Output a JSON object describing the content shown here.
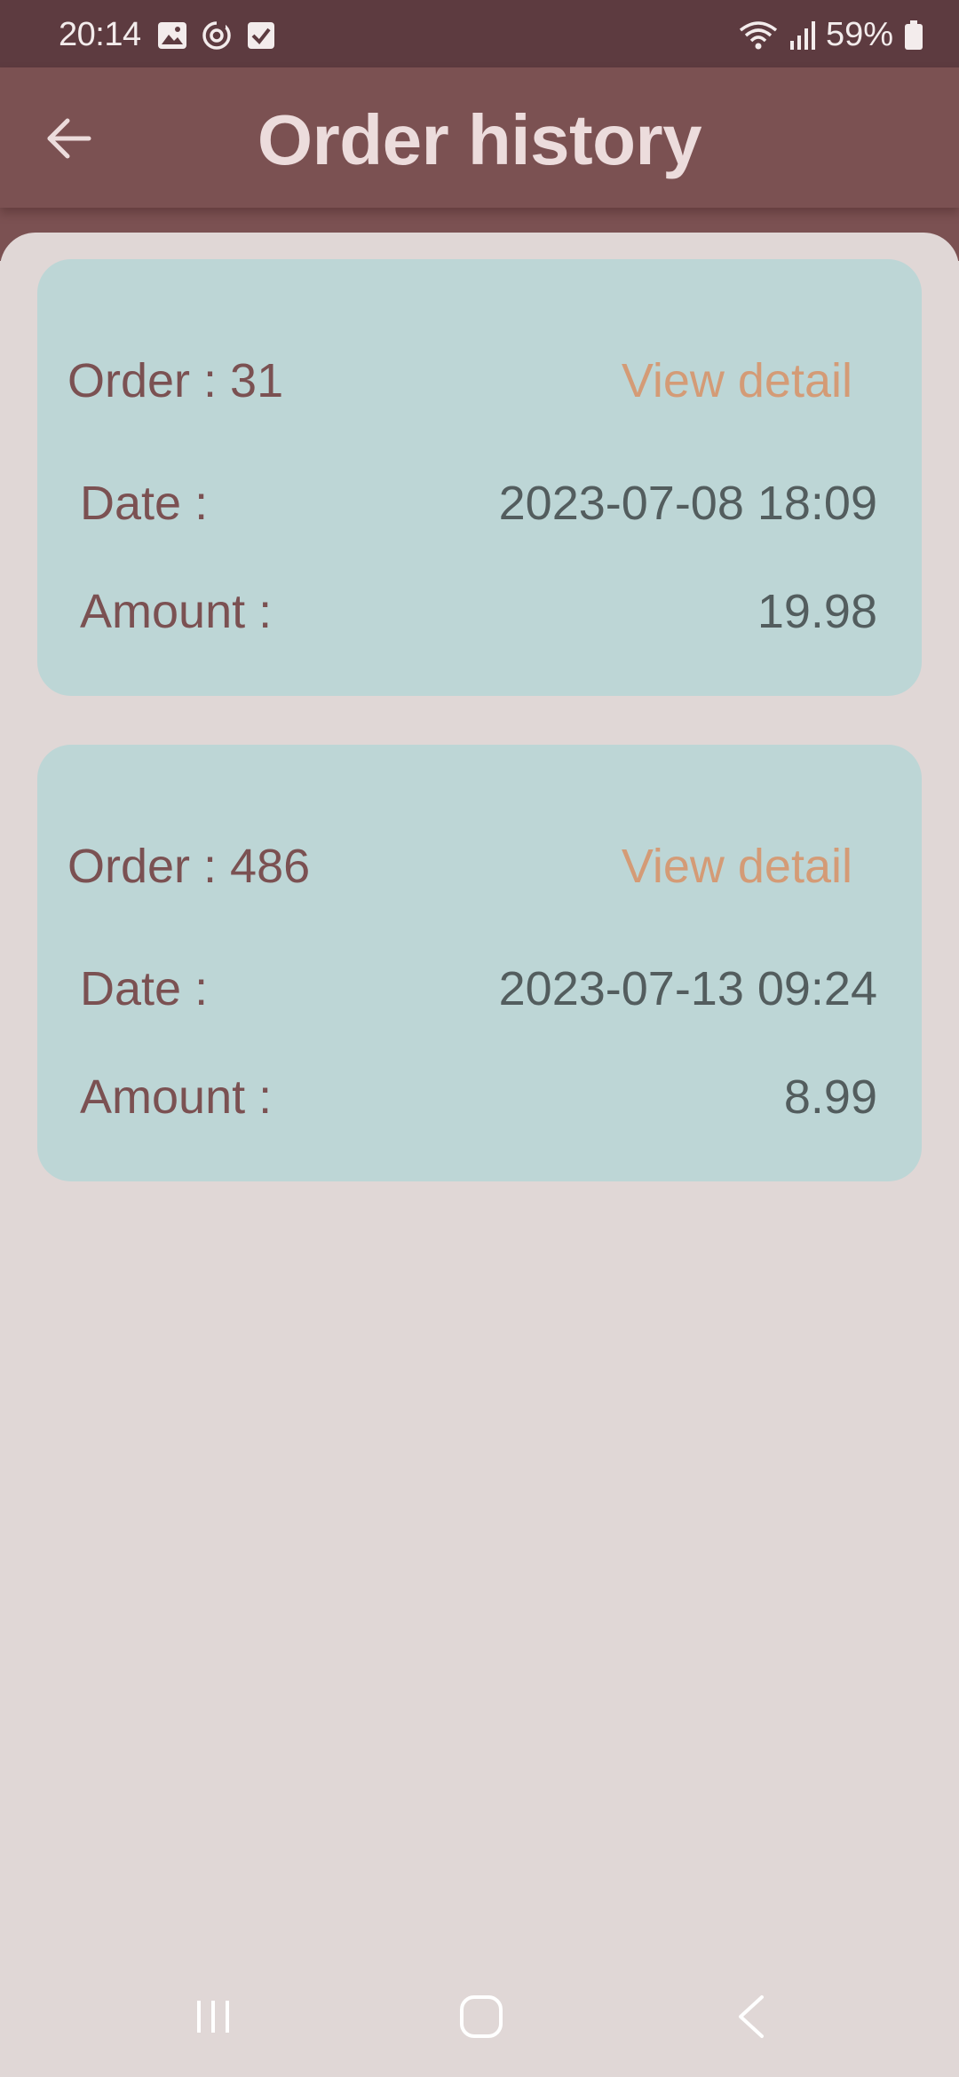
{
  "status_bar": {
    "time": "20:14",
    "battery": "59%",
    "icons": [
      "image-icon",
      "sync-icon",
      "check-box-icon",
      "wifi-icon",
      "signal-icon",
      "battery-icon"
    ]
  },
  "app_bar": {
    "title": "Order history",
    "back_icon": "arrow-left-icon"
  },
  "orders": [
    {
      "title": "Order : 31",
      "view_detail": "View detail",
      "date_label": "Date :",
      "date_value": "2023-07-08 18:09",
      "amount_label": "Amount :",
      "amount_value": "19.98"
    },
    {
      "title": "Order : 486",
      "view_detail": "View detail",
      "date_label": "Date :",
      "date_value": "2023-07-13 09:24",
      "amount_label": "Amount :",
      "amount_value": "8.99"
    }
  ],
  "nav_bar": {
    "icons": [
      "recents-icon",
      "home-icon",
      "back-icon"
    ]
  },
  "colors": {
    "status_bar": "#5d3b40",
    "app_bar": "#7b5152",
    "background": "#e0d7d6",
    "card": "#bdd6d6",
    "label": "#7b5152",
    "value": "#535d5e",
    "link": "#d49b76",
    "title_text": "#ecdcdc"
  }
}
